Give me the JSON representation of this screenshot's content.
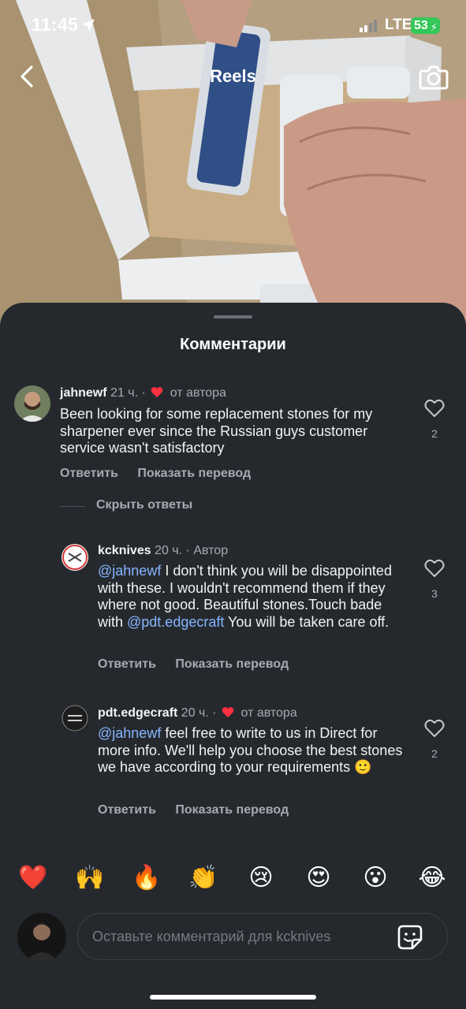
{
  "status_bar": {
    "time": "11:45",
    "network": "LTE",
    "battery": "53"
  },
  "header": {
    "title": "Reels",
    "back_icon": "chevron-left-icon",
    "camera_icon": "camera-icon"
  },
  "sheet": {
    "title": "Комментарии"
  },
  "comments": [
    {
      "username": "jahnewf",
      "time": "21 ч.",
      "separator": "·",
      "author_tag": "от автора",
      "text": "Been looking for some replacement stones for my sharpener ever since the Russian guys customer service wasn't satisfactory",
      "likes": "2",
      "reply_label": "Ответить",
      "translate_label": "Показать перевод"
    },
    {
      "username": "kcknives",
      "time": "20 ч.",
      "separator": "·",
      "author_tag": "Автор",
      "mention": "@jahnewf",
      "text_a": " I don't think you will  be disappointed with these. I wouldn't recommend them if they where not good. Beautiful  stones.Touch bade with ",
      "mention2": "@pdt.edgecraft",
      "text_b": "  You will be taken care off.",
      "likes": "3",
      "reply_label": "Ответить",
      "translate_label": "Показать перевод"
    },
    {
      "username": "pdt.edgecraft",
      "time": "20 ч.",
      "separator": "·",
      "author_tag": "от автора",
      "mention": "@jahnewf",
      "text_a": " feel free to write to us in Direct for more info. We'll help you choose the best stones we have according to your requirements 🙂",
      "likes": "2",
      "reply_label": "Ответить",
      "translate_label": "Показать перевод"
    }
  ],
  "hide_replies": "Скрыть ответы",
  "emoji_bar": [
    "❤️",
    "🙌",
    "🔥",
    "👏",
    "😢",
    "😍",
    "😮",
    "😂"
  ],
  "composer": {
    "placeholder": "Оставьте комментарий для kcknives",
    "sticker_icon": "sticker-icon"
  },
  "colors": {
    "sheet_bg": "#25292e",
    "mention": "#86b5ff",
    "heart_red": "#ff3040",
    "battery": "#34c759"
  }
}
